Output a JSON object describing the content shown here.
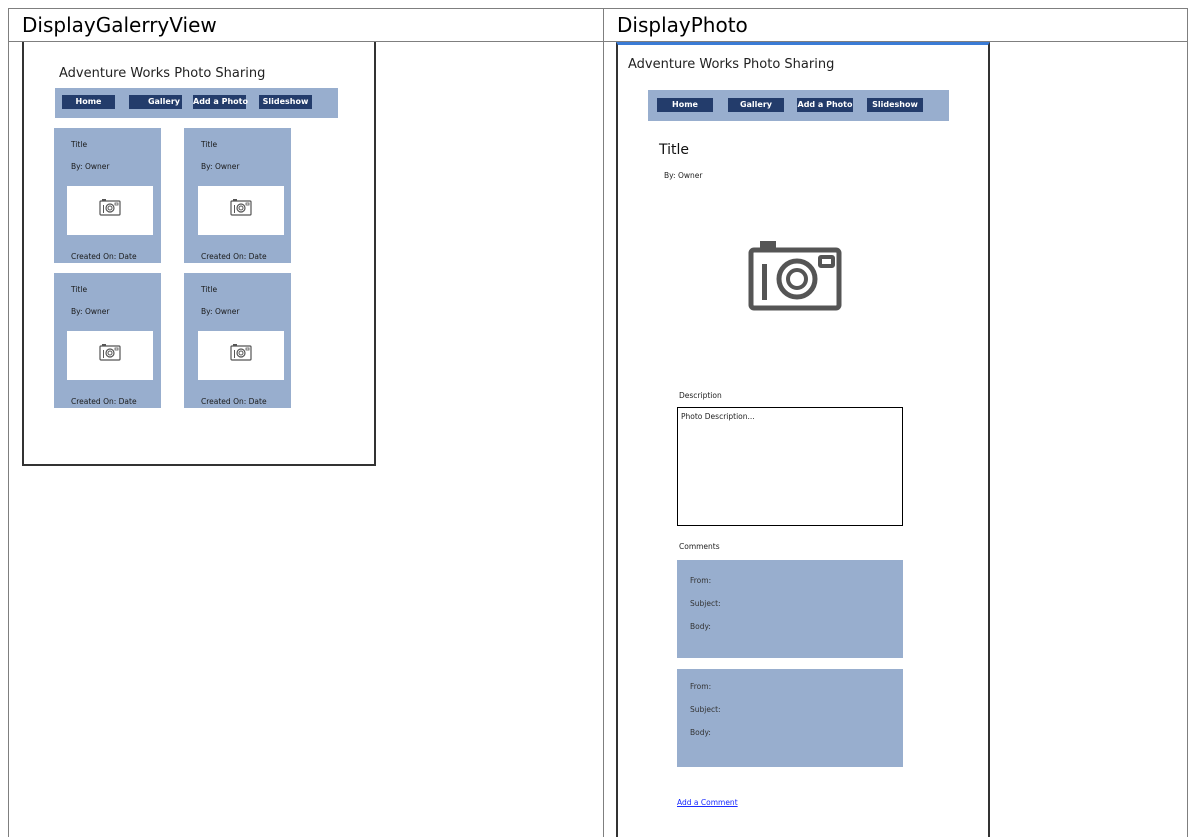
{
  "columns": [
    {
      "heading": "DisplayGalerryView"
    },
    {
      "heading": "DisplayPhoto"
    }
  ],
  "gallery": {
    "app_title": "Adventure Works Photo Sharing",
    "nav": [
      "Home",
      "Gallery",
      "Add a Photo",
      "Slideshow"
    ],
    "cards": [
      {
        "title": "Title",
        "owner": "By: Owner",
        "created": "Created On: Date"
      },
      {
        "title": "Title",
        "owner": "By: Owner",
        "created": "Created On: Date"
      },
      {
        "title": "Title",
        "owner": "By: Owner",
        "created": "Created On: Date"
      },
      {
        "title": "Title",
        "owner": "By: Owner",
        "created": "Created On: Date"
      }
    ]
  },
  "photo": {
    "app_title": "Adventure Works Photo Sharing",
    "nav": [
      "Home",
      "Gallery",
      "Add a Photo",
      "Slideshow"
    ],
    "title": "Title",
    "owner": "By: Owner",
    "description_label": "Description",
    "description_placeholder": "Photo Description...",
    "comments_label": "Comments",
    "comments": [
      {
        "from": "From:",
        "subject": "Subject:",
        "body": "Body:"
      },
      {
        "from": "From:",
        "subject": "Subject:",
        "body": "Body:"
      }
    ],
    "add_comment": "Add a Comment"
  },
  "colors": {
    "nav_button": "#233c6b",
    "panel": "#98aece",
    "link": "#1a2bff",
    "frame_accent": "#3a7bd5"
  },
  "icons": {
    "photo": "camera-icon"
  }
}
